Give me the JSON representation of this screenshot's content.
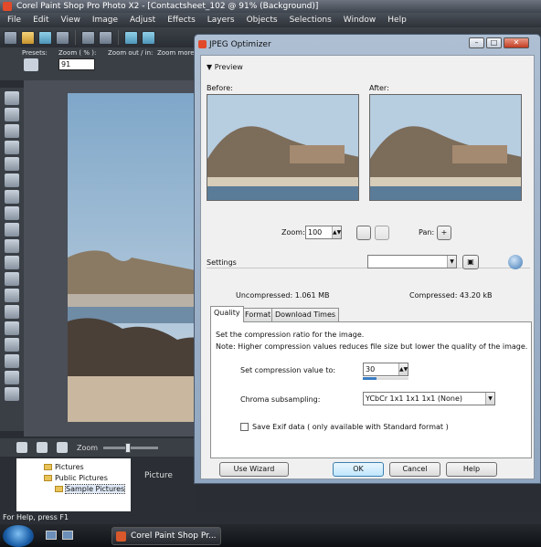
{
  "app": {
    "title": "Corel Paint Shop Pro Photo X2 - [Contactsheet_102 @  91% (Background)]",
    "menus": [
      "File",
      "Edit",
      "View",
      "Image",
      "Adjust",
      "Effects",
      "Layers",
      "Objects",
      "Selections",
      "Window",
      "Help"
    ],
    "options_bar": {
      "presets_label": "Presets:",
      "zoom_label": "Zoom ( % ):",
      "zoom_value": "91",
      "zoom_out_label": "Zoom out / in:",
      "zoom_more_label": "Zoom more"
    },
    "organizer": {
      "zoom_label": "Zoom",
      "tree": [
        "Pictures",
        "Public Pictures",
        "Sample Pictures"
      ],
      "pictures_label": "Picture"
    },
    "status": "For Help, press F1",
    "taskbar_item": "Corel Paint Shop Pr..."
  },
  "dialog": {
    "title": "JPEG Optimizer",
    "preview_header": "Preview",
    "before_label": "Before:",
    "after_label": "After:",
    "zoom_label": "Zoom:",
    "zoom_value": "100",
    "pan_label": "Pan:",
    "settings_label": "Settings",
    "settings_value": "",
    "uncompressed": "Uncompressed: 1.061 MB",
    "compressed": "Compressed: 43.20 kB",
    "tabs": [
      "Quality",
      "Format",
      "Download Times"
    ],
    "note_line1": "Set the compression ratio for the image.",
    "note_line2": "Note:  Higher compression values reduces file size but lower the quality of the image.",
    "compression_label": "Set compression value to:",
    "compression_value": "30",
    "chroma_label": "Chroma subsampling:",
    "chroma_value": "YCbCr 1x1 1x1 1x1  (None)",
    "exif_label": "Save Exif data ( only available with Standard format )",
    "buttons": {
      "wizard": "Use Wizard",
      "ok": "OK",
      "cancel": "Cancel",
      "help": "Help"
    }
  },
  "icons": [
    "gear-icon",
    "folder-icon",
    "pan-icon",
    "zoom-icon",
    "save-icon",
    "reset-icon",
    "windows-orb-icon"
  ]
}
